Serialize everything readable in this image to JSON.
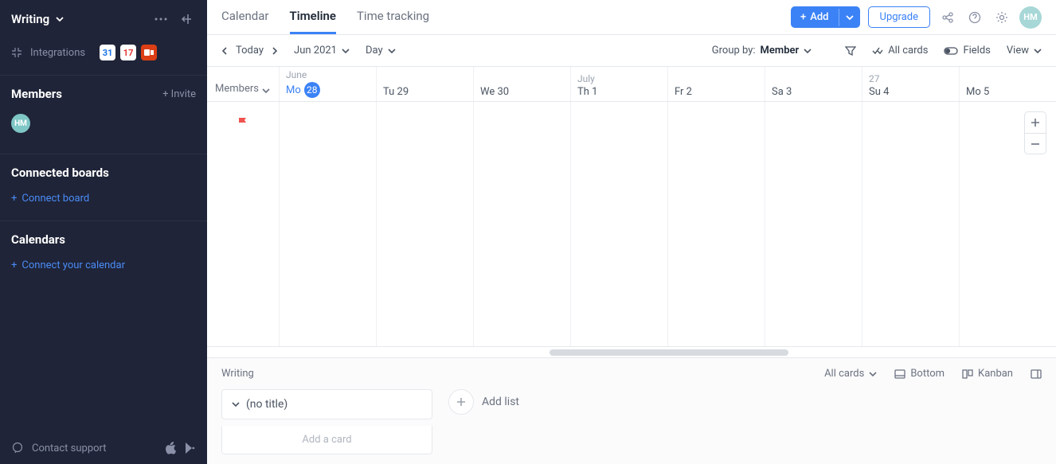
{
  "sidebar": {
    "workspace_name": "Writing",
    "integrations_label": "Integrations",
    "members": {
      "title": "Members",
      "invite_label": "+ Invite",
      "avatar_initials": "HM"
    },
    "connected_boards": {
      "title": "Connected boards",
      "link": "Connect board"
    },
    "calendars": {
      "title": "Calendars",
      "link": "Connect your calendar"
    },
    "footer": {
      "support": "Contact support"
    }
  },
  "header": {
    "tabs": [
      "Calendar",
      "Timeline",
      "Time tracking"
    ],
    "active_tab": "Timeline",
    "add_label": "Add",
    "upgrade_label": "Upgrade",
    "avatar_initials": "HM"
  },
  "toolbar": {
    "today_label": "Today",
    "month_label": "Jun 2021",
    "scale_label": "Day",
    "group_by_label": "Group by:",
    "group_by_value": "Member",
    "all_cards_label": "All cards",
    "fields_label": "Fields",
    "view_label": "View"
  },
  "timeline": {
    "members_label": "Members",
    "days": [
      {
        "month": "June",
        "dow": "Mo",
        "num": "28",
        "today": true,
        "week": ""
      },
      {
        "month": "",
        "dow": "Tu",
        "num": "29",
        "today": false,
        "week": ""
      },
      {
        "month": "",
        "dow": "We",
        "num": "30",
        "today": false,
        "week": ""
      },
      {
        "month": "July",
        "dow": "Th",
        "num": "1",
        "today": false,
        "week": ""
      },
      {
        "month": "",
        "dow": "Fr",
        "num": "2",
        "today": false,
        "week": ""
      },
      {
        "month": "",
        "dow": "Sa",
        "num": "3",
        "today": false,
        "week": ""
      },
      {
        "month": "",
        "dow": "Su",
        "num": "4",
        "today": false,
        "week": "27"
      },
      {
        "month": "",
        "dow": "Mo",
        "num": "5",
        "today": false,
        "week": ""
      }
    ]
  },
  "bottom": {
    "board_name": "Writing",
    "all_cards": "All cards",
    "bottom": "Bottom",
    "kanban": "Kanban",
    "list_title": "(no title)",
    "add_card": "Add a card",
    "add_list": "Add list"
  }
}
